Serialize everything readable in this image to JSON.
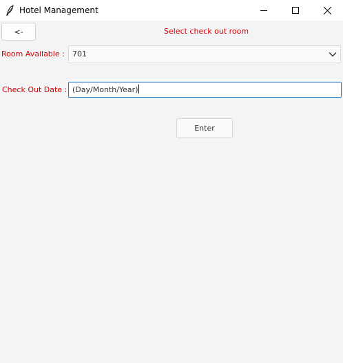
{
  "window": {
    "title": "Hotel Management",
    "app_icon": "feather-icon",
    "controls": [
      "minimize-icon",
      "maximize-icon",
      "close-icon"
    ]
  },
  "header": {
    "back_label": "<-",
    "heading": "Select check out room"
  },
  "form": {
    "room_label": "Room Available :",
    "room_value": "701",
    "date_label": "Check Out Date :",
    "date_value": "(Day/Month/Year)"
  },
  "actions": {
    "enter_label": "Enter"
  },
  "colors": {
    "label_red": "#d40000",
    "focus_border": "#1f77c8",
    "background": "#f3f4f6"
  }
}
